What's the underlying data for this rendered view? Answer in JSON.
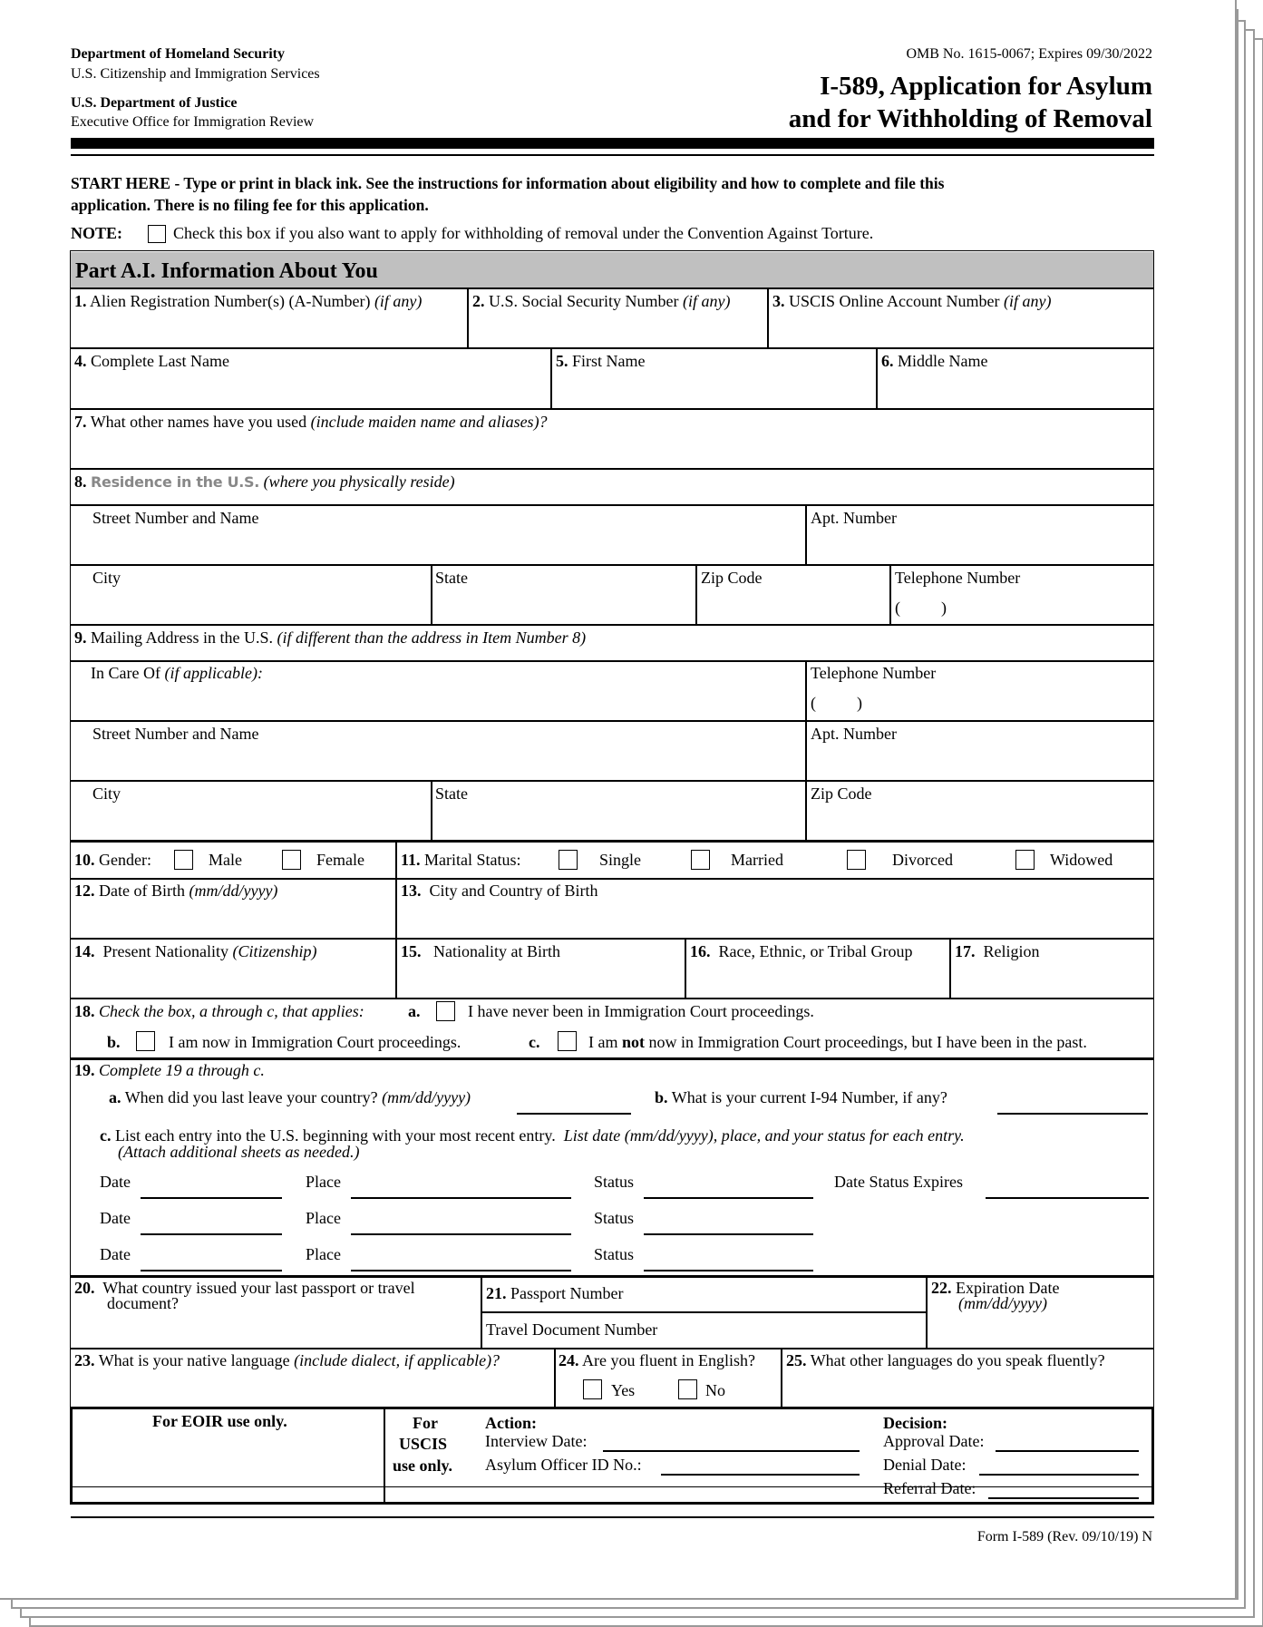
{
  "header": {
    "agency1_bold": "Department of Homeland Security",
    "agency1_sub": "U.S. Citizenship and Immigration Services",
    "agency2_bold": "U.S. Department of Justice",
    "agency2_sub": "Executive Office for Immigration Review",
    "omb": "OMB No. 1615-0067; Expires 09/30/2022",
    "title_line1": "I-589, Application for Asylum",
    "title_line2": "and for Withholding of Removal"
  },
  "intro": {
    "start_here_line1": "START HERE - Type or print in black ink.  See the instructions for information about eligibility and how to complete and file this",
    "start_here_line2": "application.  There is no filing fee for this application.",
    "note_label": "NOTE:",
    "note_text": "Check this box if you also want to apply for withholding of removal under the Convention Against Torture."
  },
  "part": {
    "title": "Part A.I.  Information About You",
    "header_bg": "#c0c0c0"
  },
  "items": {
    "q1": {
      "num": "1.",
      "label": "Alien Registration Number(s) (A-Number)",
      "hint": "(if any)"
    },
    "q2": {
      "num": "2.",
      "label": "U.S. Social Security Number",
      "hint": "(if any)"
    },
    "q3": {
      "num": "3.",
      "label": "USCIS Online Account Number",
      "hint": "(if any)"
    },
    "q4": {
      "num": "4.",
      "label": "Complete Last Name"
    },
    "q5": {
      "num": "5.",
      "label": "First Name"
    },
    "q6": {
      "num": "6.",
      "label": "Middle Name"
    },
    "q7": {
      "num": "7.",
      "label": "What other names have you used",
      "hint": "(include maiden name and aliases)?"
    },
    "q8": {
      "num": "8.",
      "label": "Residence in the U.S.",
      "hint": "(where you physically reside)",
      "street": "Street Number and Name",
      "apt": "Apt. Number",
      "city": "City",
      "state": "State",
      "zip": "Zip Code",
      "phone": "Telephone Number",
      "phone_parens": "(          )"
    },
    "q9": {
      "num": "9.",
      "label": "Mailing Address in the U.S.",
      "hint": "(if different than the address in Item Number 8)",
      "care_of": "In Care Of",
      "care_of_hint": "(if applicable):",
      "phone": "Telephone Number",
      "phone_parens": "(          )",
      "street": "Street Number and Name",
      "apt": "Apt. Number",
      "city": "City",
      "state": "State",
      "zip": "Zip Code"
    },
    "q10": {
      "num": "10.",
      "label": "Gender:",
      "options": [
        "Male",
        "Female"
      ]
    },
    "q11": {
      "num": "11.",
      "label": "Marital Status:",
      "options": [
        "Single",
        "Married",
        "Divorced",
        "Widowed"
      ]
    },
    "q12": {
      "num": "12.",
      "label": "Date of Birth",
      "hint": "(mm/dd/yyyy)"
    },
    "q13": {
      "num": "13.",
      "label": "City and Country of Birth"
    },
    "q14": {
      "num": "14.",
      "label": "Present Nationality",
      "hint": "(Citizenship)"
    },
    "q15": {
      "num": "15.",
      "label": "Nationality at Birth"
    },
    "q16": {
      "num": "16.",
      "label": "Race, Ethnic, or Tribal Group"
    },
    "q17": {
      "num": "17.",
      "label": "Religion"
    },
    "q18": {
      "num": "18.",
      "label": "Check the box, a through c, that applies:",
      "a_letter": "a.",
      "a_text": "I have never been in Immigration Court proceedings.",
      "b_letter": "b.",
      "b_text": "I am now in Immigration Court proceedings.",
      "c_letter": "c.",
      "c_text_pre": "I am ",
      "c_text_bold": "not",
      "c_text_post": " now in Immigration Court proceedings, but I have been in the past."
    },
    "q19": {
      "num": "19.",
      "label": "Complete 19 a through c.",
      "a_letter": "a.",
      "a_text": "When did you last leave your country?",
      "a_hint": "(mm/dd/yyyy)",
      "b_letter": "b.",
      "b_text": "What is your current I-94 Number, if any?",
      "c_letter": "c.",
      "c_text": "List each entry into the U.S. beginning with your most recent entry.",
      "c_hint": "List date (mm/dd/yyyy), place, and your status for each entry.",
      "c_hint2": "(Attach additional sheets as needed.)",
      "entries": [
        {
          "date": "Date",
          "place": "Place",
          "status": "Status",
          "expires": "Date Status Expires"
        },
        {
          "date": "Date",
          "place": "Place",
          "status": "Status"
        },
        {
          "date": "Date",
          "place": "Place",
          "status": "Status"
        }
      ]
    },
    "q20": {
      "num": "20.",
      "label_line1": "What country issued your last passport or travel",
      "label_line2": "document?"
    },
    "q21": {
      "num": "21.",
      "label": "Passport Number",
      "travel_doc": "Travel Document Number"
    },
    "q22": {
      "num": "22.",
      "label": "Expiration Date",
      "hint": "(mm/dd/yyyy)"
    },
    "q23": {
      "num": "23.",
      "label": "What is your native language",
      "hint": "(include dialect, if applicable)?"
    },
    "q24": {
      "num": "24.",
      "label": "Are you fluent in English?",
      "options": [
        "Yes",
        "No"
      ]
    },
    "q25": {
      "num": "25.",
      "label": "What other languages do you speak fluently?"
    }
  },
  "office_use": {
    "eoir": "For EOIR use only.",
    "uscis_line1": "For",
    "uscis_line2": "USCIS",
    "uscis_line3": "use only.",
    "action": "Action:",
    "interview_date": "Interview Date:",
    "officer_id": "Asylum Officer ID No.:",
    "decision": "Decision:",
    "approval_date": "Approval Date:",
    "denial_date": "Denial Date:",
    "referral_date": "Referral Date:"
  },
  "footer": {
    "form_id": "Form I-589 (Rev. 09/10/19) N"
  }
}
